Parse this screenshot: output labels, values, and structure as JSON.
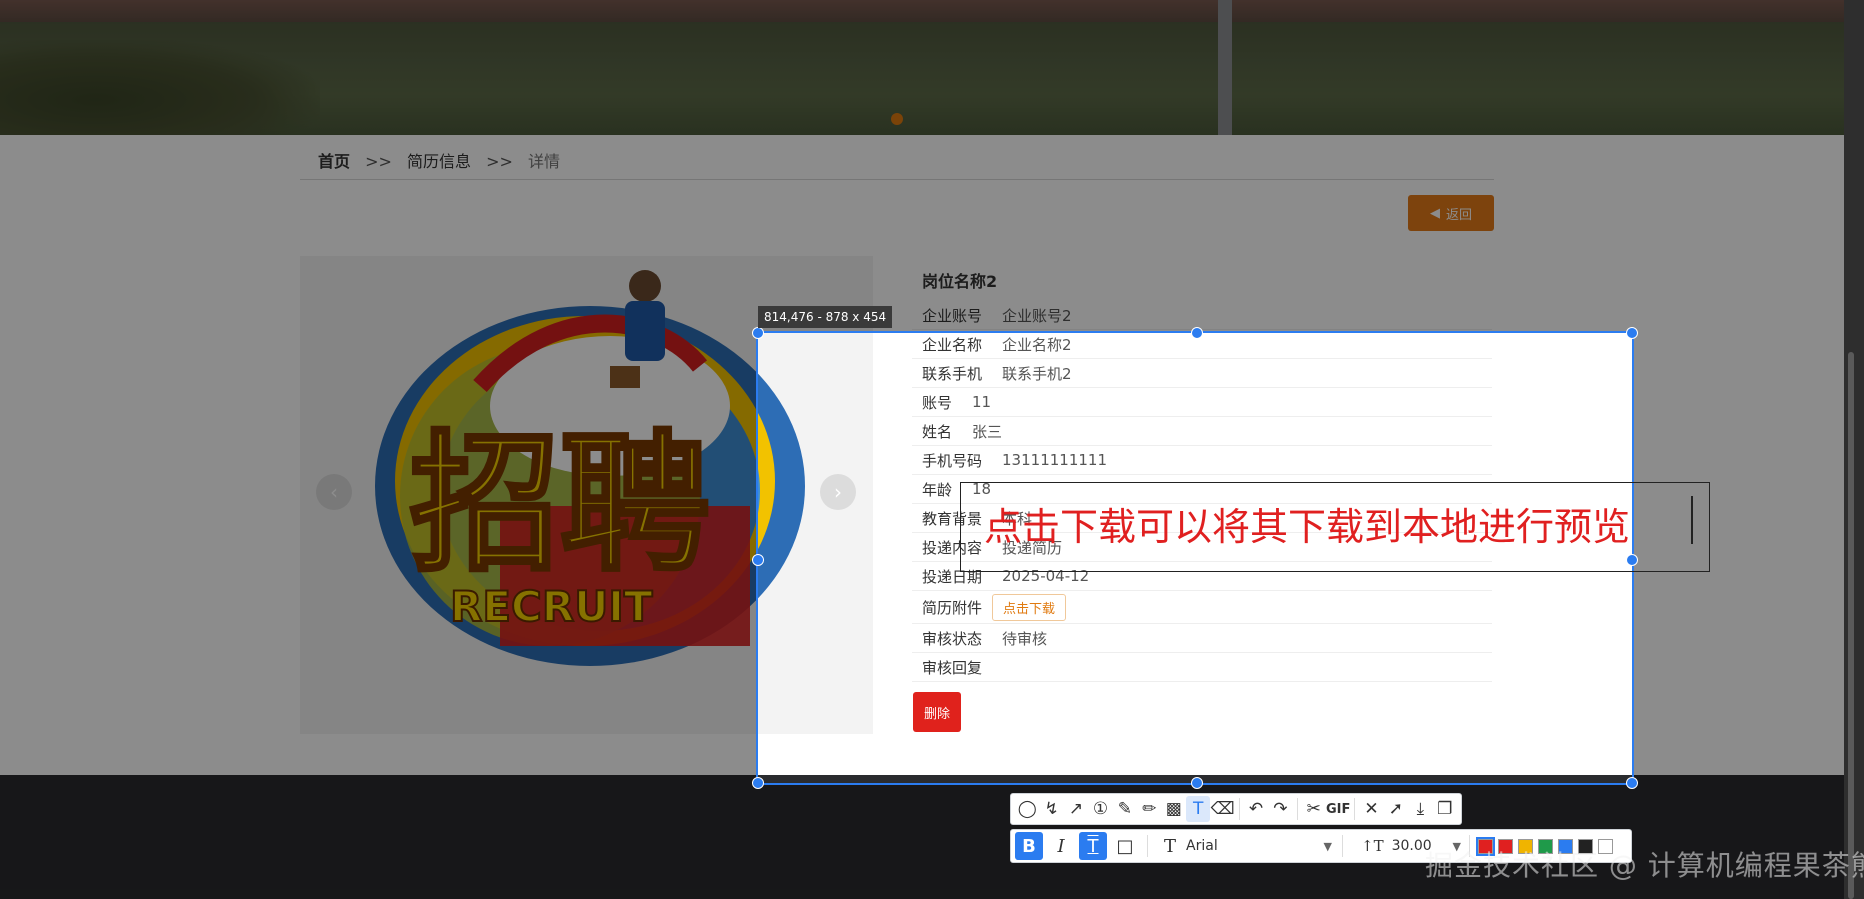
{
  "breadcrumb": {
    "home": "首页",
    "sep": ">>",
    "section": "简历信息",
    "current": "详情"
  },
  "back_button": {
    "label": "返回"
  },
  "detail": {
    "job_title": "岗位名称2",
    "rows": [
      {
        "key": "企业账号",
        "value": "企业账号2"
      },
      {
        "key": "企业名称",
        "value": "企业名称2"
      },
      {
        "key": "联系手机",
        "value": "联系手机2"
      },
      {
        "key": "账号",
        "value": "11"
      },
      {
        "key": "姓名",
        "value": "张三"
      },
      {
        "key": "手机号码",
        "value": "13111111111"
      },
      {
        "key": "年龄",
        "value": "18"
      },
      {
        "key": "教育背景",
        "value": "本科"
      },
      {
        "key": "投递内容",
        "value": "投递简历"
      },
      {
        "key": "投递日期",
        "value": "2025-04-12"
      },
      {
        "key": "简历附件",
        "value": ""
      },
      {
        "key": "审核状态",
        "value": "待审核"
      },
      {
        "key": "审核回复",
        "value": ""
      }
    ],
    "download_label": "点击下载",
    "delete_label": "删除"
  },
  "carousel": {
    "text_main": "招聘",
    "text_sub": "RECRUIT"
  },
  "screenshot_tool": {
    "selection_info": "814,476 - 878 x 454",
    "annotation_text": "点击下载可以将其下载到本地进行预览",
    "font_name": "Arial",
    "font_size": "30.00",
    "gif_label": "GIF",
    "step_marker": "①",
    "colors": [
      "#e02020",
      "#e02020",
      "#f0b400",
      "#1f9a4a",
      "#2b7cf0",
      "#222222",
      "#ffffff"
    ],
    "icons": [
      "shape-icon",
      "polyline-icon",
      "arrow-icon",
      "number-marker-icon",
      "pen-icon",
      "marker-icon",
      "mosaic-icon",
      "text-icon",
      "eraser-icon",
      "undo-icon",
      "redo-icon",
      "scroll-capture-icon",
      "gif-icon",
      "close-icon",
      "pin-icon",
      "save-icon",
      "copy-icon"
    ]
  },
  "watermark": "掘金技术社区 @ 计算机编程果茶熊"
}
